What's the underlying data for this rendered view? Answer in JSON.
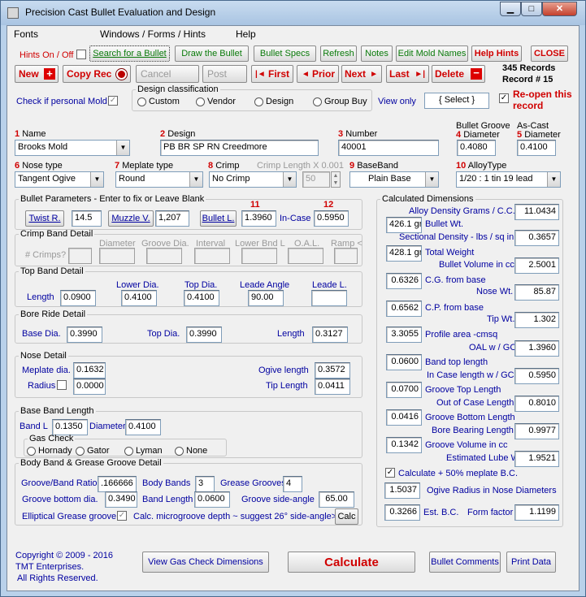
{
  "title": "Precision Cast Bullet Evaluation and Design",
  "window_buttons": {
    "minimize": "▁",
    "maximize": "□",
    "close": "✕"
  },
  "menu": [
    "Fonts",
    "Windows / Forms / Hints",
    "Help"
  ],
  "toolbar": {
    "hints_label": "Hints On / Off",
    "search": "Search for a Bullet",
    "draw": "Draw the Bullet",
    "specs": "Bullet Specs",
    "refresh": "Refresh",
    "notes": "Notes",
    "edit_mold": "Edit Mold Names",
    "help_hints": "Help Hints",
    "close": "CLOSE"
  },
  "nav": {
    "new": "New",
    "copy": "Copy Rec",
    "cancel": "Cancel",
    "post": "Post",
    "first": "First",
    "prior": "Prior",
    "next": "Next",
    "last": "Last",
    "delete": "Delete",
    "records": "345  Records",
    "record_no": "Record # 15",
    "reopen": "Re-open this record"
  },
  "classification": {
    "legend": "Design classification",
    "options": [
      "Custom",
      "Vendor",
      "Design",
      "Group Buy"
    ],
    "personal": "Check if personal Mold",
    "view_only": "View only",
    "select": "{ Select }"
  },
  "fields": {
    "name": {
      "num": "1",
      "label": "Name",
      "value": "Brooks Mold"
    },
    "design": {
      "num": "2",
      "label": "Design",
      "value": "PB BR SP RN Creedmore"
    },
    "number": {
      "num": "3",
      "label": "Number",
      "value": "40001"
    },
    "bgd": {
      "top": "Bullet Groove",
      "num": "4",
      "label": "Diameter",
      "value": "0.4080"
    },
    "acd": {
      "top": "As-Cast",
      "num": "5",
      "label": "Diameter",
      "value": "0.4100"
    },
    "nose": {
      "num": "6",
      "label": "Nose type",
      "value": "Tangent Ogive"
    },
    "meplate": {
      "num": "7",
      "label": "Meplate type",
      "value": "Round"
    },
    "crimp": {
      "num": "8",
      "label": "Crimp",
      "value": "No Crimp",
      "len_label": "Crimp Length X 0.001",
      "len_value": "50"
    },
    "baseband": {
      "num": "9",
      "label": "BaseBand",
      "value": "Plain Base"
    },
    "alloy": {
      "num": "10",
      "label": "AlloyType",
      "value": "1/20 : 1 tin 19 lead"
    }
  },
  "params": {
    "legend": "Bullet Parameters - Enter to fix or Leave Blank",
    "twist_btn": "Twist R.",
    "twist": "14.5",
    "muzzle_btn": "Muzzle V.",
    "muzzle": "1,207",
    "bl_btn": "Bullet L.",
    "num11": "11",
    "bl": "1.3960",
    "incase_label": "In-Case",
    "num12": "12",
    "incase": "0.5950"
  },
  "crimpband": {
    "legend": "Crimp Band Detail",
    "crimps": "# Crimps?",
    "diameter": "Diameter",
    "groove_dia": "Groove Dia.",
    "interval": "Interval",
    "lower_bnd": "Lower Bnd L",
    "oal": "O.A.L.",
    "ramp": "Ramp <"
  },
  "topband": {
    "legend": "Top Band Detail",
    "length_label": "Length",
    "length": "0.0900",
    "lower_label": "Lower Dia.",
    "lower": "0.4100",
    "top_label": "Top Dia.",
    "top": "0.4100",
    "leade_angle_label": "Leade Angle",
    "leade_angle": "90.00",
    "leade_l_label": "Leade L.",
    "leade_l": ""
  },
  "boreride": {
    "legend": "Bore Ride Detail",
    "base_label": "Base Dia.",
    "base": "0.3990",
    "top_label": "Top Dia.",
    "top": "0.3990",
    "length_label": "Length",
    "length": "0.3127"
  },
  "nosedetail": {
    "legend": "Nose Detail",
    "meplate_label": "Meplate dia.",
    "meplate": "0.1632",
    "radius_label": "Radius",
    "radius": "0.0000",
    "ogive_label": "Ogive length",
    "ogive": "0.3572",
    "tip_label": "Tip Length",
    "tip": "0.0411"
  },
  "basebandlen": {
    "legend": "Base Band Length",
    "bandl_label": "Band L",
    "bandl": "0.1350",
    "dia_label": "Diameter",
    "dia": "0.4100",
    "gas_legend": "Gas Check",
    "gas": [
      "Hornady",
      "Gator",
      "Lyman",
      "None"
    ]
  },
  "bodyband": {
    "legend": "Body Band & Grease Groove Detail",
    "ratio_label": "Groove/Band Ratio",
    "ratio": ".166666",
    "bands_label": "Body Bands",
    "bands": "3",
    "grooves_label": "Grease Grooves",
    "grooves": "4",
    "gbd_label": "Groove bottom dia.",
    "gbd": "0.3490",
    "bandlen_label": "Band Length",
    "bandlen": "0.0600",
    "side_label": "Groove side-angle",
    "side": "65.00",
    "elliptical": "Elliptical Grease groove",
    "micro": "Calc. microgroove depth ~ suggest 26° side-angle>",
    "calc_btn": "Calc"
  },
  "calc": {
    "legend": "Calculated Dimensions",
    "alloy_label": "Alloy Density Grams / C.C.",
    "alloy": "11.0434",
    "bw": "426.1 gr",
    "bw_label": "Bullet Wt.",
    "sd_label": "Sectional Density - lbs / sq in",
    "sd": "0.3657",
    "tw": "428.1 gr",
    "tw_label": "Total  Weight",
    "vol_label": "Bullet Volume in cc",
    "vol": "2.5001",
    "cg": "0.6326",
    "cg_label": "C.G. from base",
    "nosewt_label": "Nose Wt.",
    "nosewt": "85.87",
    "cp": "0.6562",
    "cp_label": "C.P. from base",
    "tipwt_label": "Tip Wt.",
    "tipwt": "1.302",
    "pa": "3.3055",
    "pa_label": "Profile area -cmsq",
    "oal_label": "OAL w / GC",
    "oal": "1.3960",
    "btl": "0.0600",
    "btl_label": "Band top length",
    "icl_label": "In Case length w / GC",
    "icl": "0.5950",
    "gtl": "0.0700",
    "gtl_label": "Groove Top Length",
    "ocl_label": "Out of Case Length",
    "ocl": "0.8010",
    "gbl": "0.0416",
    "gbl_label": "Groove Bottom Length",
    "bbl_label": "Bore Bearing Length",
    "bbl": "0.9977",
    "gv": "0.1342",
    "gv_label": "Groove Volume in cc",
    "elw_label": "Estimated Lube Weight",
    "elw": "1.9521",
    "mep_label": "Calculate + 50% meplate B.C.",
    "ogr": "1.5037",
    "ogr_label": "Ogive Radius in Nose Diameters",
    "bc": "0.3266",
    "bc_label": "Est. B.C.",
    "ff_label": "Form factor",
    "ff": "1.1199"
  },
  "footer": {
    "copyright": "Copyright © 2009 - 2016",
    "company": "TMT Enterprises.",
    "rights": "All Rights Reserved.",
    "gas_btn": "View Gas Check Dimensions",
    "calculate": "Calculate",
    "comments": "Bullet Comments",
    "print": "Print Data"
  }
}
